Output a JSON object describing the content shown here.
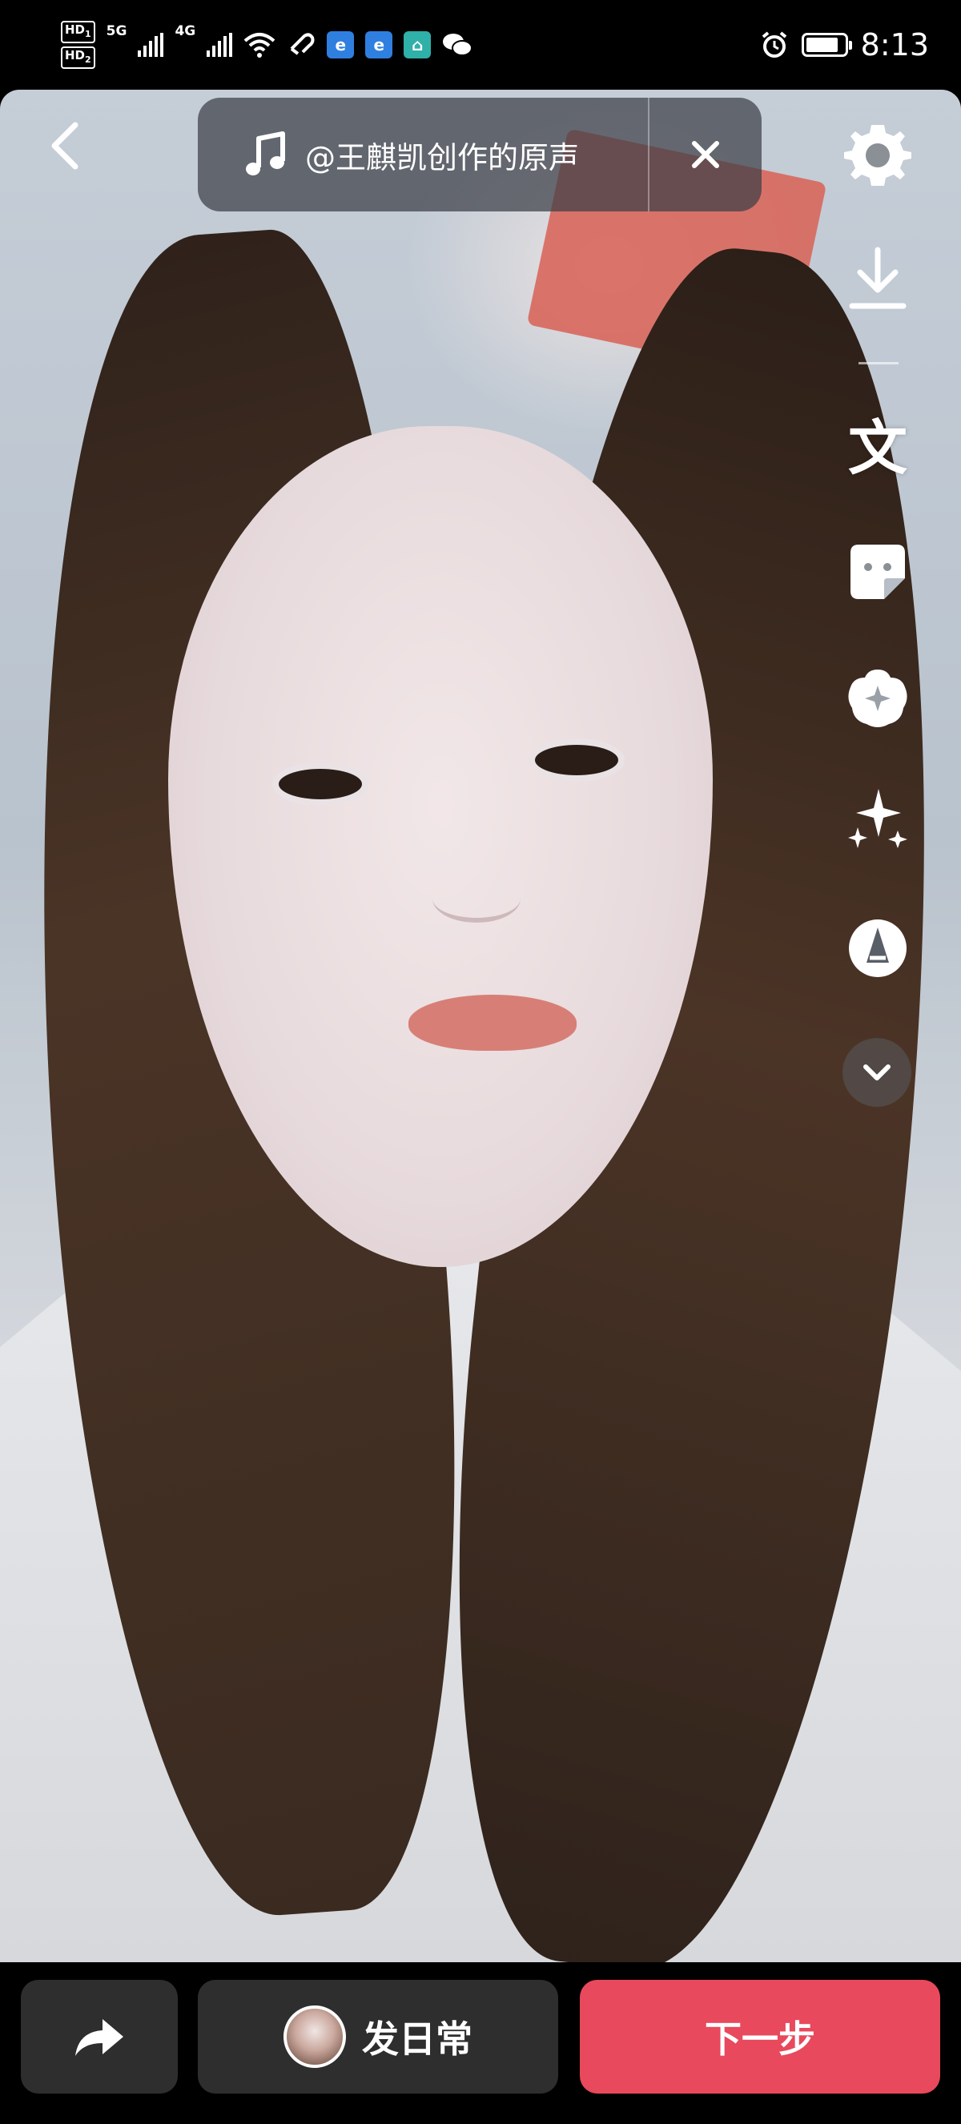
{
  "status_bar": {
    "hd1": "HD",
    "hd1_sub": "1",
    "hd2": "HD",
    "hd2_sub": "2",
    "network_5g": "5G",
    "network_4g": "4G",
    "time": "8:13",
    "battery_level": 0.85,
    "icons": [
      "signal-icon",
      "wifi-icon",
      "link-icon",
      "app-e-icon",
      "app-e-icon",
      "home-app-icon",
      "wechat-icon",
      "alarm-icon",
      "battery-icon"
    ]
  },
  "music": {
    "title": "@王麒凯创作的原声"
  },
  "toolbar": {
    "items": [
      "settings-icon",
      "download-icon",
      "text-icon",
      "sticker-icon",
      "effects-icon",
      "sparkle-icon",
      "pen-icon",
      "expand-icon"
    ],
    "text_glyph": "文"
  },
  "bottom": {
    "daily_label": "发日常",
    "next_label": "下一步"
  },
  "colors": {
    "accent": "#e8495c",
    "button_dark": "#2e2e2e",
    "pill_bg": "#3c3e46"
  }
}
